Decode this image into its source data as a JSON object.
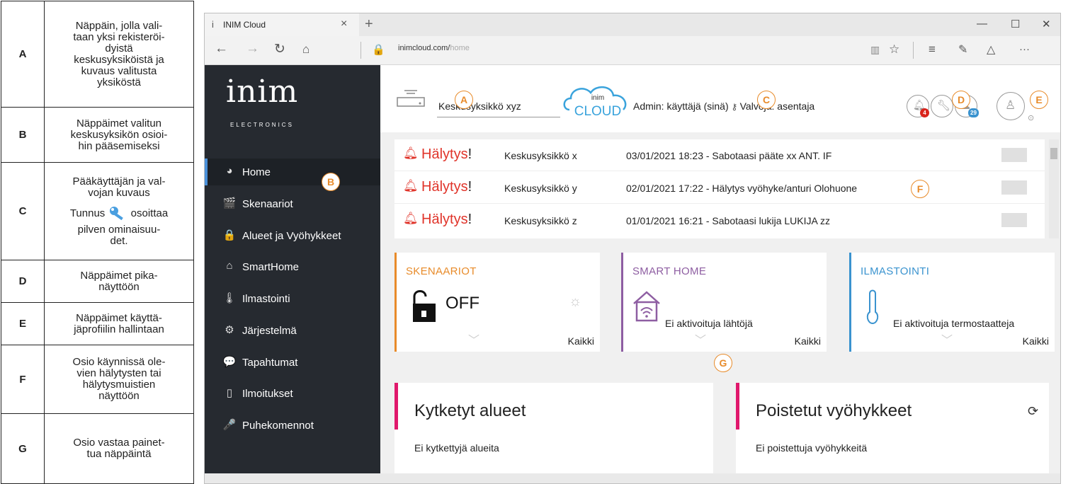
{
  "legend": [
    {
      "key": "A",
      "lines": [
        "Näppäin, jolla vali-",
        "taan yksi rekisteröi-",
        "dyistä",
        "keskusyksiköistä ja",
        "kuvaus valitusta",
        "yksiköstä"
      ]
    },
    {
      "key": "B",
      "lines": [
        "Näppäimet valitun",
        "keskusyksikön osioi-",
        "hin pääsemiseksi"
      ]
    },
    {
      "key": "C",
      "lines": [
        "Pääkäyttäjän ja val-",
        "vojan kuvaus"
      ],
      "tunnus": "Tunnus",
      "osoittaa": "osoittaa",
      "lines2": [
        "pilven ominaisuu-",
        "det."
      ]
    },
    {
      "key": "D",
      "lines": [
        "Näppäimet pika-",
        "näyttöön"
      ]
    },
    {
      "key": "E",
      "lines": [
        "Näppäimet käyttä-",
        "jäprofiilin hallintaan"
      ]
    },
    {
      "key": "F",
      "lines": [
        "Osio käynnissä ole-",
        "vien hälytysten tai",
        "hälytysmuistien",
        "näyttöön"
      ]
    },
    {
      "key": "G",
      "lines": [
        "Osio vastaa painet-",
        "tua näppäintä"
      ]
    }
  ],
  "browser": {
    "tab_title": "INIM Cloud",
    "url_host": "inimcloud.com/",
    "url_path": "home"
  },
  "logo": {
    "text": "inim",
    "sub": "ELECTRONICS"
  },
  "nav": [
    {
      "icon": "dashboard-icon",
      "glyph": "◕",
      "label": "Home",
      "active": true
    },
    {
      "icon": "clapperboard-icon",
      "glyph": "🎬",
      "label": "Skenaariot"
    },
    {
      "icon": "lock-icon",
      "glyph": "🔒",
      "label": "Alueet ja Vyöhykkeet"
    },
    {
      "icon": "smarthome-icon",
      "glyph": "⌂",
      "label": "SmartHome"
    },
    {
      "icon": "thermometer-icon",
      "glyph": "🌡",
      "label": "Ilmastointi"
    },
    {
      "icon": "gears-icon",
      "glyph": "⚙",
      "label": "Järjestelmä"
    },
    {
      "icon": "chat-icon",
      "glyph": "💬",
      "label": "Tapahtumat"
    },
    {
      "icon": "phone-icon",
      "glyph": "▯",
      "label": "Ilmoitukset"
    },
    {
      "icon": "microphone-icon",
      "glyph": "🎤",
      "label": "Puhekomennot"
    }
  ],
  "topbar": {
    "unit_name": "Keskusyksikkö xyz",
    "cloud_text": "CLOUD",
    "cloud_inim": "inim",
    "admin_text": "Admin: käyttäjä (sinä)",
    "supervisor_text": "Valvoja: asentaja",
    "badge_alarm": "4",
    "badge_cloud": "29"
  },
  "alerts": [
    {
      "type": "Hälytys",
      "excl": "!",
      "unit": "Keskusyksikkö x",
      "desc": "03/01/2021 18:23 - Sabotaasi pääte xx ANT. IF"
    },
    {
      "type": "Hälytys",
      "excl": "!",
      "unit": "Keskusyksikkö y",
      "desc": "02/01/2021 17:22 - Hälytys vyöhyke/anturi Olohuone"
    },
    {
      "type": "Hälytys",
      "excl": "!",
      "unit": "Keskusyksikkö z",
      "desc": "01/01/2021 16:21 - Sabotaasi lukija LUKIJA zz"
    }
  ],
  "cards": {
    "skenaariot": {
      "title": "SKENAARIOT",
      "value": "OFF",
      "all": "Kaikki",
      "color": "#e88b2a"
    },
    "smarthome": {
      "title": "SMART HOME",
      "text": "Ei aktivoituja lähtöjä",
      "all": "Kaikki",
      "color": "#8e5ea2"
    },
    "ilmastointi": {
      "title": "ILMASTOINTI",
      "text": "Ei aktivoituja termostaatteja",
      "all": "Kaikki",
      "color": "#3a93cf"
    }
  },
  "panels": {
    "kytketyt": {
      "title": "Kytketyt alueet",
      "text": "Ei kytkettyjä alueita"
    },
    "poistetut": {
      "title": "Poistetut vyöhykkeet",
      "text": "Ei poistettuja vyöhykkeitä"
    }
  },
  "callouts": {
    "a": "A",
    "b": "B",
    "c": "C",
    "d": "D",
    "e": "E",
    "f": "F",
    "g": "G"
  }
}
